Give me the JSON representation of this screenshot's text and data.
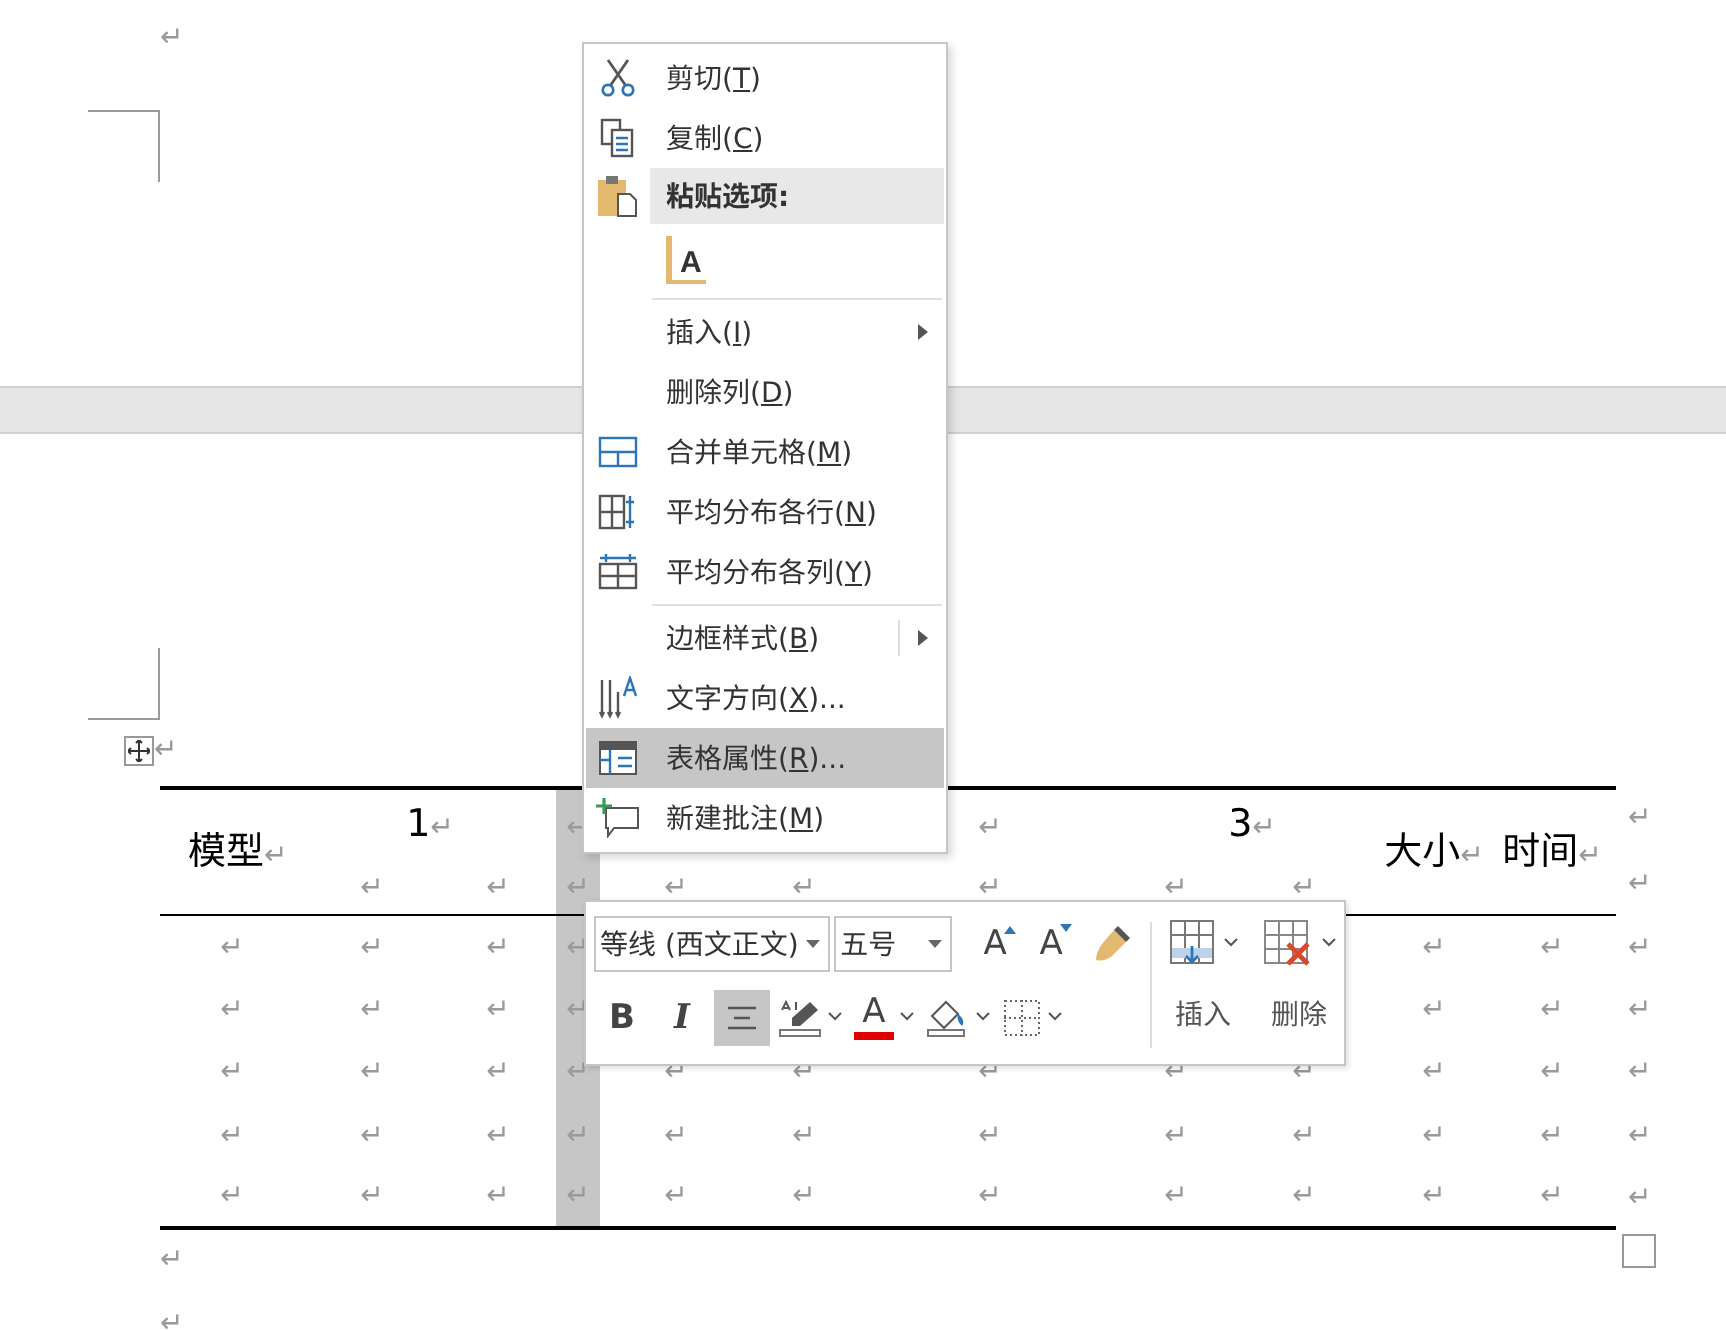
{
  "page_top": {
    "paragraph_mark": "↵"
  },
  "table_anchor_mark": "↵",
  "table": {
    "columns": [
      {
        "selected": false
      },
      {
        "selected": false
      },
      {
        "selected": false
      },
      {
        "selected": true
      },
      {
        "selected": false
      },
      {
        "selected": false
      },
      {
        "selected": false
      },
      {
        "selected": false
      },
      {
        "selected": false
      },
      {
        "selected": false
      },
      {
        "selected": false
      }
    ],
    "header_lines": [
      {
        "cells": [
          {
            "text": "模型",
            "mark": "↵"
          },
          {
            "text": "1",
            "mark": "↵"
          },
          {
            "mark": "↵"
          },
          {
            "mark": "↵"
          },
          {
            "text": "3",
            "mark": "↵"
          },
          {
            "text": "大小",
            "mark": "↵"
          },
          {
            "text": "时间",
            "mark": "↵"
          }
        ]
      },
      {
        "cells": [
          {
            "mark": "↵"
          },
          {
            "mark": "↵"
          },
          {
            "mark": "↵"
          },
          {
            "mark": "↵"
          },
          {
            "mark": "↵"
          },
          {
            "mark": "↵"
          },
          {
            "mark": "↵"
          },
          {
            "mark": "↵"
          }
        ]
      }
    ],
    "header_row_ends": [
      "↵",
      "↵"
    ],
    "rows": [
      {
        "cells": [
          "↵",
          "↵",
          "↵",
          "↵",
          "↵",
          "↵"
        ],
        "row_end": "↵"
      },
      {
        "cells": [
          "↵",
          "↵",
          "↵",
          "↵",
          "↵",
          "↵"
        ],
        "row_end": "↵"
      },
      {
        "cells": [
          "↵",
          "↵",
          "↵",
          "↵",
          "↵",
          "↵",
          "↵",
          "↵",
          "↵",
          "↵",
          "↵"
        ],
        "row_end": "↵"
      },
      {
        "cells": [
          "↵",
          "↵",
          "↵",
          "↵",
          "↵",
          "↵",
          "↵",
          "↵",
          "↵",
          "↵",
          "↵"
        ],
        "row_end": "↵"
      },
      {
        "cells": [
          "↵",
          "↵",
          "↵",
          "↵",
          "↵",
          "↵",
          "↵",
          "↵",
          "↵",
          "↵",
          "↵"
        ],
        "row_end": "↵"
      }
    ]
  },
  "after_table_marks": [
    "↵",
    "↵"
  ],
  "context_menu": {
    "items": [
      {
        "kind": "command",
        "label_before": "剪切(",
        "key": "T",
        "label_after": ")",
        "submenu": false,
        "selected": false
      },
      {
        "kind": "command",
        "label_before": "复制(",
        "key": "C",
        "label_after": ")",
        "submenu": false,
        "selected": false
      },
      {
        "kind": "header",
        "label_before": "粘贴选项:"
      },
      {
        "kind": "paste-option",
        "glyph": "A"
      },
      {
        "kind": "separator"
      },
      {
        "kind": "command",
        "label_before": "插入(",
        "key": "I",
        "label_after": ")",
        "submenu": true,
        "selected": false
      },
      {
        "kind": "command",
        "label_before": "删除列(",
        "key": "D",
        "label_after": ")",
        "submenu": false,
        "selected": false
      },
      {
        "kind": "command",
        "label_before": "合并单元格(",
        "key": "M",
        "label_after": ")",
        "submenu": false,
        "selected": false
      },
      {
        "kind": "command",
        "label_before": "平均分布各行(",
        "key": "N",
        "label_after": ")",
        "submenu": false,
        "selected": false
      },
      {
        "kind": "command",
        "label_before": "平均分布各列(",
        "key": "Y",
        "label_after": ")",
        "submenu": false,
        "selected": false
      },
      {
        "kind": "separator"
      },
      {
        "kind": "split",
        "label_before": "边框样式(",
        "key": "B",
        "label_after": ")",
        "submenu": true,
        "selected": false
      },
      {
        "kind": "command",
        "label_before": "文字方向(",
        "key": "X",
        "label_after": ")...",
        "submenu": false,
        "selected": false
      },
      {
        "kind": "command",
        "label_before": "表格属性(",
        "key": "R",
        "label_after": ")...",
        "submenu": false,
        "selected": true
      },
      {
        "kind": "command",
        "label_before": "新建批注(",
        "key": "M",
        "label_after": ")",
        "submenu": false,
        "selected": false
      }
    ]
  },
  "mini_toolbar": {
    "font_name": {
      "value": "等线 (西文正文)"
    },
    "font_size": {
      "value": "五号"
    },
    "font_buttons": [
      {
        "kind": "grow-font",
        "glyph": "A"
      },
      {
        "kind": "shrink-font",
        "glyph": "A"
      },
      {
        "kind": "format-painter"
      }
    ],
    "toggles": [
      {
        "kind": "bold",
        "glyph": "B",
        "selected": false
      },
      {
        "kind": "italic",
        "glyph": "I",
        "selected": false
      },
      {
        "kind": "center",
        "selected": true
      }
    ],
    "dropdowns": [
      {
        "kind": "highlight"
      },
      {
        "kind": "font-color",
        "glyph": "A"
      },
      {
        "kind": "shading"
      },
      {
        "kind": "borders"
      }
    ],
    "table_actions": [
      {
        "kind": "insert",
        "label": "插入"
      },
      {
        "kind": "delete",
        "label": "删除"
      }
    ]
  }
}
